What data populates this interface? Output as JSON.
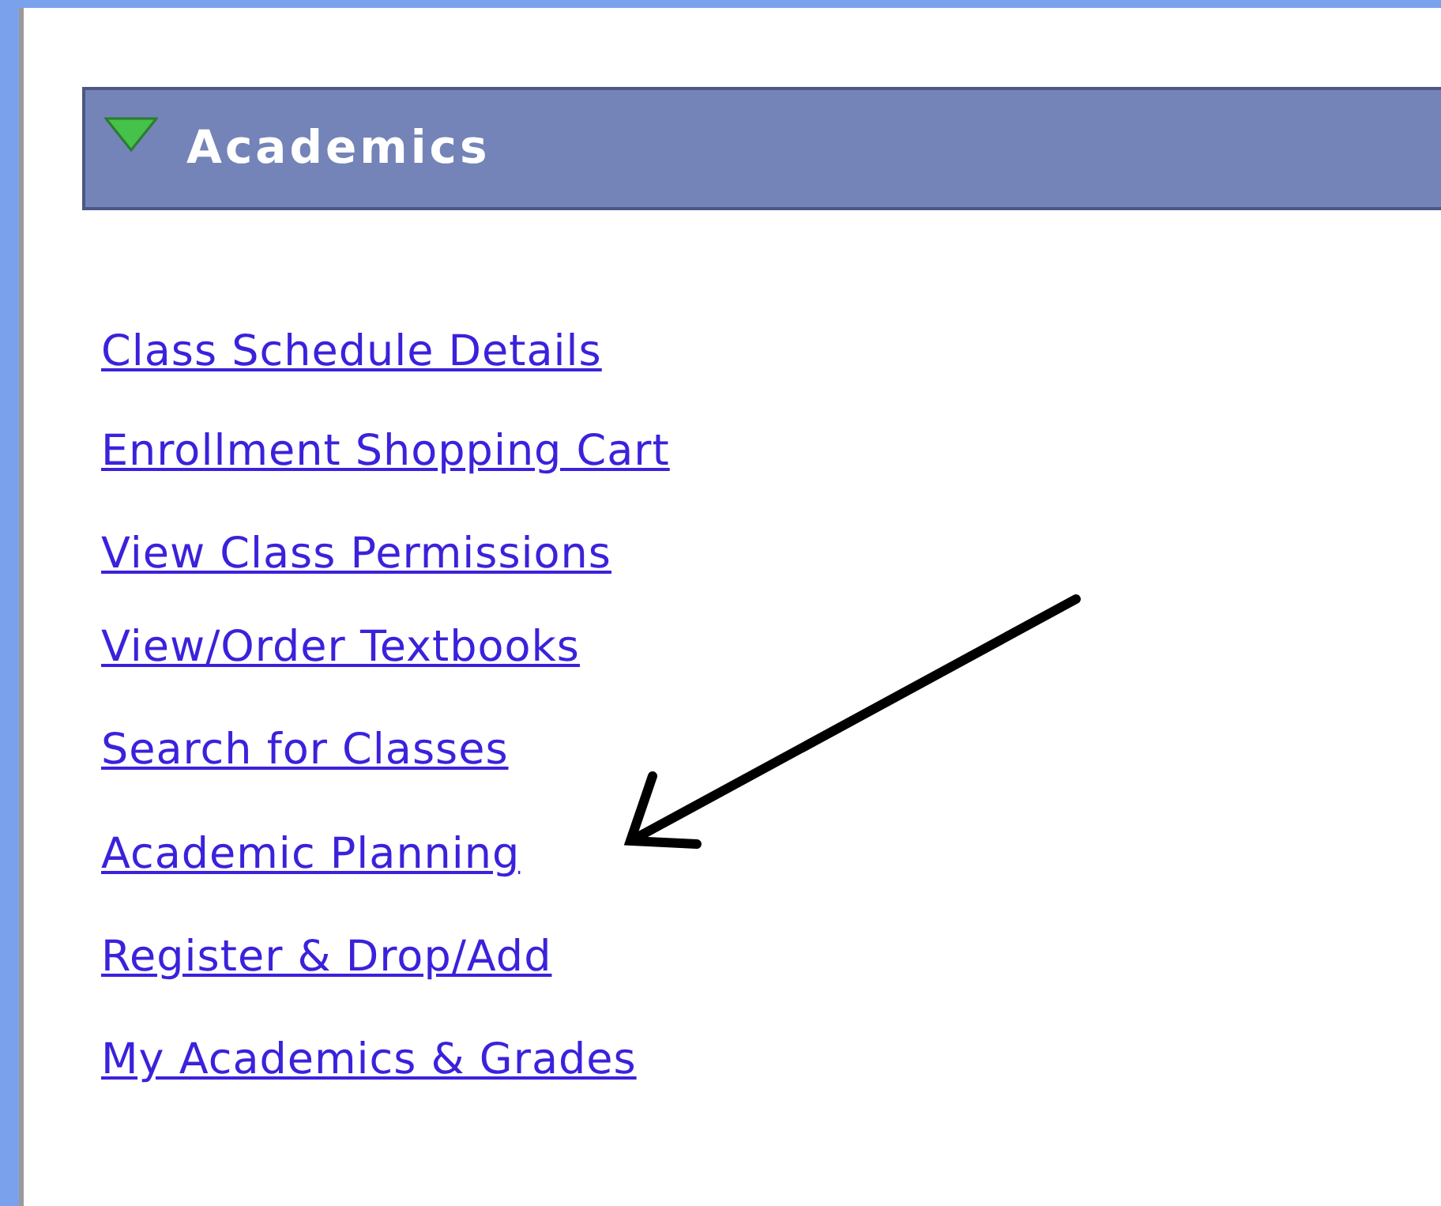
{
  "section": {
    "title": "Academics",
    "expanded": true
  },
  "links": [
    {
      "label": "Class Schedule Details"
    },
    {
      "label": "Enrollment Shopping Cart"
    },
    {
      "label": "View Class Permissions"
    },
    {
      "label": "View/Order Textbooks"
    },
    {
      "label": "Search for Classes"
    },
    {
      "label": "Academic Planning"
    },
    {
      "label": "Register & Drop/Add"
    },
    {
      "label": "My Academics & Grades"
    }
  ]
}
